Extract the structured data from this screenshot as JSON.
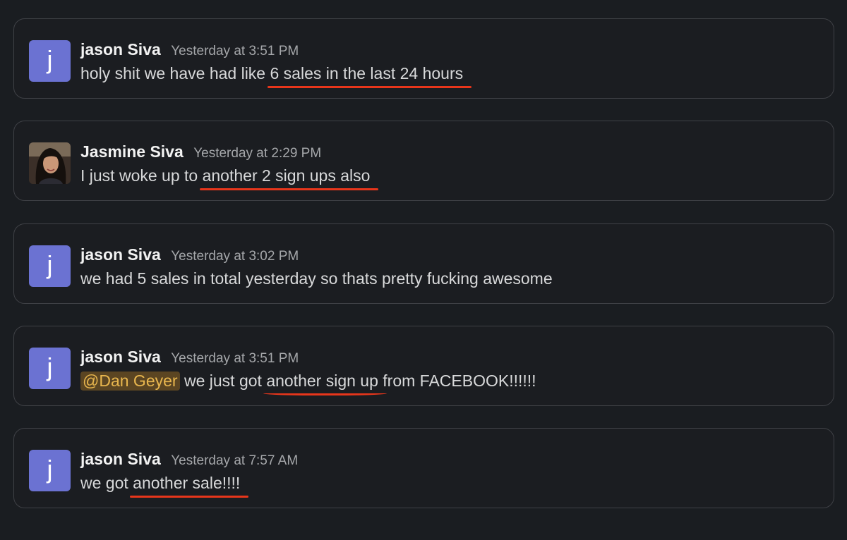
{
  "messages": [
    {
      "author": "jason Siva",
      "avatar_initial": "j",
      "avatar_type": "initial",
      "time": "Yesterday at 3:51 PM",
      "text_before": "holy shit we have had like ",
      "highlight": "6 sales in the last 24 hours",
      "text_after": ""
    },
    {
      "author": "Jasmine Siva",
      "avatar_type": "photo",
      "time": "Yesterday at 2:29 PM",
      "text_before": "I just woke up to ",
      "highlight": "another 2 sign ups also",
      "text_after": ""
    },
    {
      "author": "jason Siva",
      "avatar_initial": "j",
      "avatar_type": "initial",
      "time": "Yesterday at 3:02 PM",
      "text": "we had 5 sales in total yesterday so thats pretty fucking awesome"
    },
    {
      "author": "jason Siva",
      "avatar_initial": "j",
      "avatar_type": "initial",
      "time": "Yesterday at 3:51 PM",
      "mention": "@Dan Geyer",
      "text_before": " we just got ",
      "highlight": "another sign up",
      "text_after": " from FACEBOOK!!!!!!"
    },
    {
      "author": "jason Siva",
      "avatar_initial": "j",
      "avatar_type": "initial",
      "time": "Yesterday at 7:57 AM",
      "text_before": "we got ",
      "highlight": "another sale!!!!",
      "text_after": ""
    }
  ],
  "colors": {
    "background": "#1a1d21",
    "avatar": "#6b72d2",
    "underline": "#e8361b",
    "mention_bg": "#5b4522",
    "mention_text": "#e8b64e"
  }
}
